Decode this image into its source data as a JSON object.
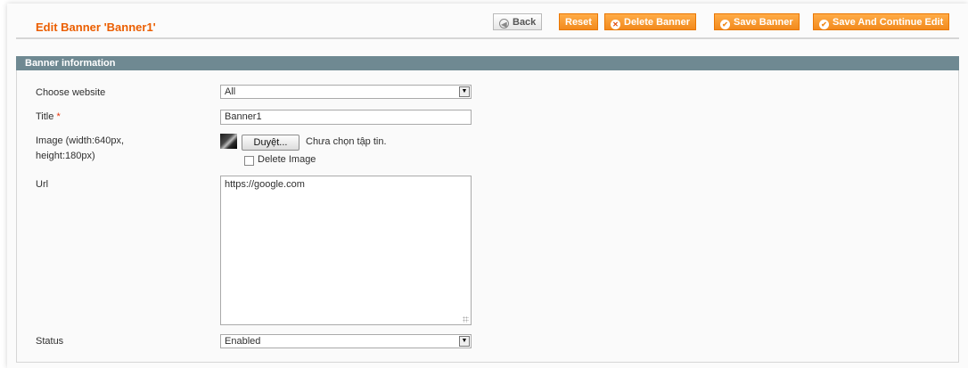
{
  "header": {
    "title": "Edit Banner 'Banner1'",
    "buttons": {
      "back": "Back",
      "reset": "Reset",
      "delete": "Delete Banner",
      "save": "Save Banner",
      "save_continue": "Save And Continue Edit"
    }
  },
  "fieldset": {
    "title": "Banner information"
  },
  "form": {
    "website": {
      "label": "Choose website",
      "value": "All"
    },
    "title": {
      "label": "Title",
      "required_mark": "*",
      "value": "Banner1"
    },
    "image": {
      "label_line1": "Image (width:640px,",
      "label_line2": "height:180px)",
      "browse_label": "Duyệt...",
      "no_file_text": "Chưa chọn tập tin.",
      "delete_label": "Delete Image",
      "delete_checked": false
    },
    "url": {
      "label": "Url",
      "value": "https://google.com"
    },
    "status": {
      "label": "Status",
      "value": "Enabled"
    }
  },
  "colors": {
    "accent": "#eb5e00",
    "button_orange": "#f28a1d",
    "fieldset_header": "#6f8992"
  },
  "icons": {
    "back": "back-arrow-icon",
    "delete": "delete-x-icon",
    "save": "checkmark-icon",
    "select_arrow": "dropdown-arrow-icon"
  }
}
